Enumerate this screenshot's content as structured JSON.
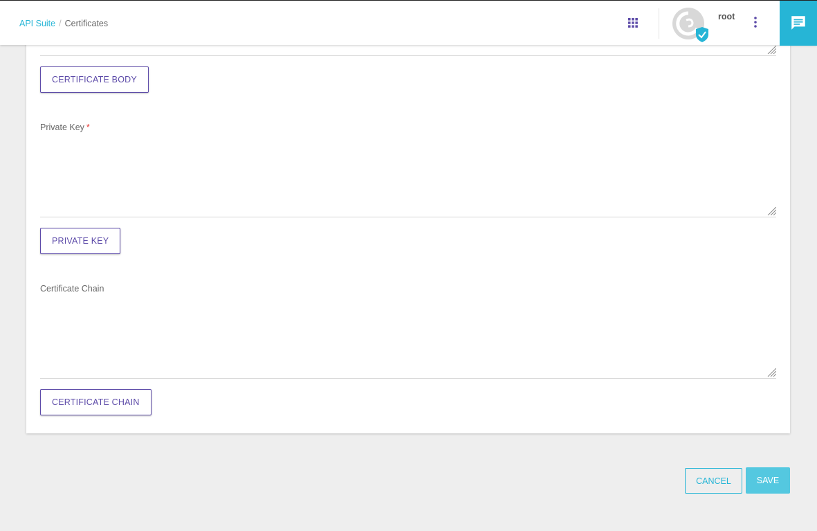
{
  "breadcrumb": {
    "parent": "API Suite",
    "separator": "/",
    "current": "Certificates"
  },
  "header": {
    "username": "root",
    "icons": [
      "apps-grid-icon",
      "avatar-verified-icon",
      "more-vert-icon",
      "chat-icon"
    ]
  },
  "form": {
    "certificate_body_button": "CERTIFICATE BODY",
    "private_key": {
      "label": "Private Key",
      "required_mark": "*",
      "value": "",
      "button": "PRIVATE KEY"
    },
    "certificate_chain": {
      "label": "Certificate Chain",
      "value": "",
      "button": "CERTIFICATE CHAIN"
    }
  },
  "actions": {
    "cancel": "CANCEL",
    "save": "SAVE"
  },
  "colors": {
    "accent": "#26b5d6",
    "primary_purple": "#5c4aa8",
    "save_bg": "#54c8e0",
    "required": "#e53935",
    "page_bg": "#eeeeee"
  }
}
